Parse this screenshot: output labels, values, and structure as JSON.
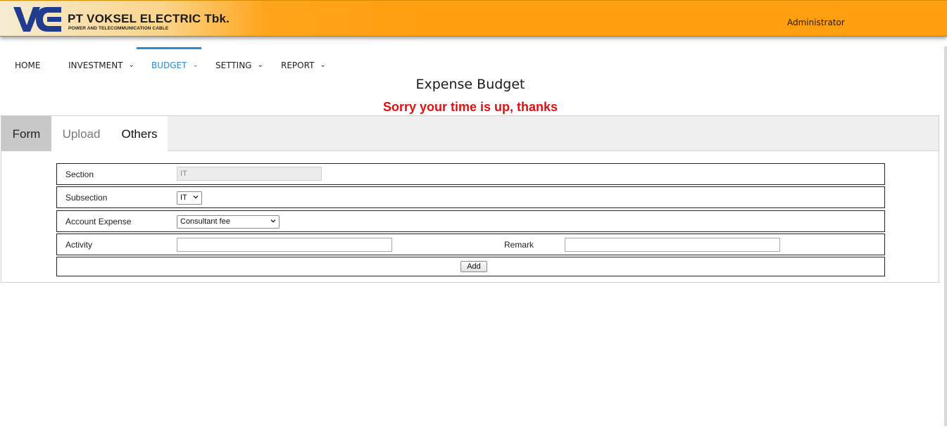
{
  "header": {
    "company": "PT VOKSEL ELECTRIC Tbk.",
    "tagline": "POWER AND TELECOMMUNICATION CABLE",
    "logo_icon": "vc-logo",
    "user": "Administrator",
    "colors": {
      "bar": "#ff9f10",
      "logo": "#1f3c8f"
    }
  },
  "nav": {
    "items": [
      {
        "label": "HOME",
        "dropdown": false
      },
      {
        "label": "INVESTMENT",
        "dropdown": true
      },
      {
        "label": "BUDGET",
        "dropdown": true,
        "active": true
      },
      {
        "label": "SETTING",
        "dropdown": true
      },
      {
        "label": "REPORT",
        "dropdown": true
      }
    ],
    "active_color": "#2a8bd0"
  },
  "page": {
    "title": "Expense Budget",
    "warning": "Sorry your time is up, thanks",
    "warning_color": "#e01010"
  },
  "tabs": [
    {
      "label": "Form",
      "active": true
    },
    {
      "label": "Upload"
    },
    {
      "label": "Others"
    }
  ],
  "form": {
    "section_label": "Section",
    "section_value": "IT",
    "subsection_label": "Subsection",
    "subsection_value": "IT",
    "account_label": "Account Expense",
    "account_value": "Consultant fee",
    "activity_label": "Activity",
    "activity_value": "",
    "remark_label": "Remark",
    "remark_value": "",
    "add_label": "Add"
  }
}
